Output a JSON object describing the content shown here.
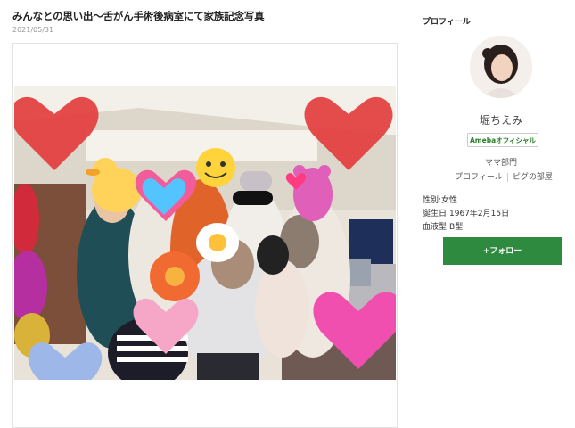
{
  "article": {
    "title": "みんなとの思い出〜舌がん手術後病室にて家族記念写真",
    "date": "2021/05/31"
  },
  "profile": {
    "heading": "プロフィール",
    "name": "堀ちえみ",
    "badge": "Amebaオフィシャル",
    "category": "ママ部門",
    "link_profile": "プロフィール",
    "link_room": "ピグの部屋",
    "gender": "性別:女性",
    "birthday": "誕生日:1967年2月15日",
    "blood_type": "血液型:B型",
    "follow_label": "+フォロー"
  },
  "colors": {
    "follow_button": "#2d8a3e",
    "badge_text": "#2a7f2a"
  }
}
